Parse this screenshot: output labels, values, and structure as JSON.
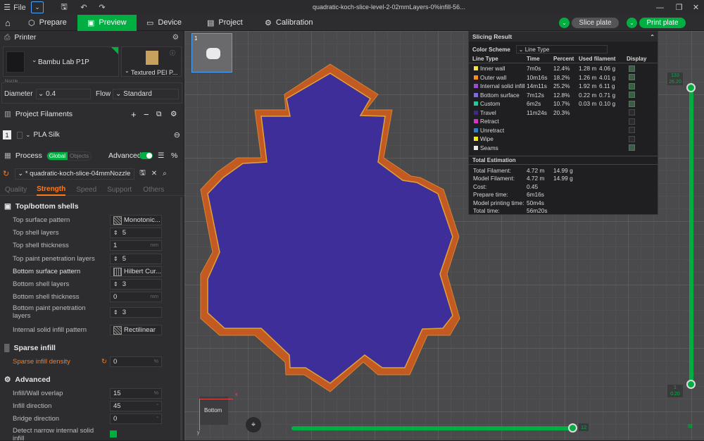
{
  "titlebar": {
    "file_label": "File",
    "filename": "quadratic-koch-slice-level-2-02mmLayers-0%infill-56..."
  },
  "tabs": [
    {
      "label": "Prepare"
    },
    {
      "label": "Preview"
    },
    {
      "label": "Device"
    },
    {
      "label": "Project"
    },
    {
      "label": "Calibration"
    }
  ],
  "actions": {
    "slice_label": "Slice plate",
    "print_label": "Print plate"
  },
  "printer": {
    "heading": "Printer",
    "name": "Bambu Lab P1P",
    "plate": "Textured PEI P...",
    "nozzle_caption": "Nozzle",
    "diameter_label": "Diameter",
    "diameter_value": "0.4",
    "flow_label": "Flow",
    "flow_value": "Standard"
  },
  "filaments": {
    "heading": "Project Filaments",
    "items": [
      {
        "index": "1",
        "name": "PLA Silk"
      }
    ]
  },
  "process": {
    "heading": "Process",
    "badge_global": "Global",
    "badge_objects": "Objects",
    "advanced_label": "Advanced",
    "profile": "* quadratic-koch-slice-04mmNozzle"
  },
  "subtabs": [
    {
      "label": "Quality"
    },
    {
      "label": "Strength"
    },
    {
      "label": "Speed"
    },
    {
      "label": "Support"
    },
    {
      "label": "Others"
    }
  ],
  "shells": {
    "heading": "Top/bottom shells",
    "rows": [
      {
        "label": "Top surface pattern",
        "value": "Monotonic..."
      },
      {
        "label": "Top shell layers",
        "value": "5"
      },
      {
        "label": "Top shell thickness",
        "value": "1",
        "unit": "mm"
      },
      {
        "label": "Top paint penetration layers",
        "value": "5"
      },
      {
        "label": "Bottom surface pattern",
        "value": "Hilbert Cur..."
      },
      {
        "label": "Bottom shell layers",
        "value": "3"
      },
      {
        "label": "Bottom shell thickness",
        "value": "0",
        "unit": "mm"
      },
      {
        "label": "Bottom paint penetration layers",
        "value": "3"
      },
      {
        "label": "Internal solid infill pattern",
        "value": "Rectilinear"
      }
    ]
  },
  "sparse": {
    "heading": "Sparse infill",
    "density_label": "Sparse infill density",
    "density_value": "0",
    "unit": "%"
  },
  "advanced": {
    "heading": "Advanced",
    "rows": [
      {
        "label": "Infill/Wall overlap",
        "value": "15",
        "unit": "%"
      },
      {
        "label": "Infill direction",
        "value": "45",
        "unit": "°"
      },
      {
        "label": "Bridge direction",
        "value": "0",
        "unit": "°"
      },
      {
        "label": "Detect narrow internal solid infill"
      }
    ]
  },
  "plate_thumb": {
    "number": "1"
  },
  "view": {
    "cube_label": "Bottom",
    "axis_x": "x",
    "axis_y": "y"
  },
  "layer_slider": {
    "top_layer": "133",
    "top_height": "26.20",
    "bottom_layer": "1",
    "bottom_height": "0.20"
  },
  "move_slider": {
    "value": "12"
  },
  "slicing": {
    "title": "Slicing Result",
    "color_scheme_label": "Color Scheme",
    "color_scheme_value": "Line Type",
    "headers": {
      "line_type": "Line Type",
      "time": "Time",
      "percent": "Percent",
      "used": "Used filament",
      "display": "Display"
    },
    "rows": [
      {
        "name": "Inner wall",
        "color": "#f5e14d",
        "time": "7m0s",
        "percent": "12.4%",
        "length": "1.28 m",
        "weight": "4.06 g",
        "display": true
      },
      {
        "name": "Outer wall",
        "color": "#ff8a1f",
        "time": "10m16s",
        "percent": "18.2%",
        "length": "1.26 m",
        "weight": "4.01 g",
        "display": true
      },
      {
        "name": "Internal solid infill",
        "color": "#9a4cd6",
        "time": "14m11s",
        "percent": "25.2%",
        "length": "1.92 m",
        "weight": "6.11 g",
        "display": true
      },
      {
        "name": "Bottom surface",
        "color": "#7b6ce6",
        "time": "7m12s",
        "percent": "12.8%",
        "length": "0.22 m",
        "weight": "0.71 g",
        "display": true
      },
      {
        "name": "Custom",
        "color": "#27c99b",
        "time": "6m2s",
        "percent": "10.7%",
        "length": "0.03 m",
        "weight": "0.10 g",
        "display": true
      },
      {
        "name": "Travel",
        "color": "#3b2a8a",
        "time": "11m24s",
        "percent": "20.3%",
        "length": "",
        "weight": "",
        "display": false
      },
      {
        "name": "Retract",
        "color": "#d635c9",
        "time": "",
        "percent": "",
        "length": "",
        "weight": "",
        "display": false
      },
      {
        "name": "Unretract",
        "color": "#2f7fd1",
        "time": "",
        "percent": "",
        "length": "",
        "weight": "",
        "display": false
      },
      {
        "name": "Wipe",
        "color": "#f5e62a",
        "time": "",
        "percent": "",
        "length": "",
        "weight": "",
        "display": false
      },
      {
        "name": "Seams",
        "color": "#e8e8e8",
        "time": "",
        "percent": "",
        "length": "",
        "weight": "",
        "display": true
      }
    ],
    "estimation_title": "Total Estimation",
    "estimation": [
      {
        "label": "Total Filament:",
        "value": "4.72 m",
        "value2": "14.99 g"
      },
      {
        "label": "Model Filament:",
        "value": "4.72 m",
        "value2": "14.99 g"
      },
      {
        "label": "Cost:",
        "value": "0.45",
        "value2": ""
      },
      {
        "label": "Prepare time:",
        "value": "6m16s",
        "value2": ""
      },
      {
        "label": "Model printing time:",
        "value": "50m4s",
        "value2": ""
      },
      {
        "label": "Total time:",
        "value": "56m20s",
        "value2": ""
      }
    ]
  },
  "colors": {
    "accent": "#00ae42",
    "orange": "#ff7a1a",
    "model_fill": "#3e2e9a",
    "model_edge": "#c25a22"
  }
}
